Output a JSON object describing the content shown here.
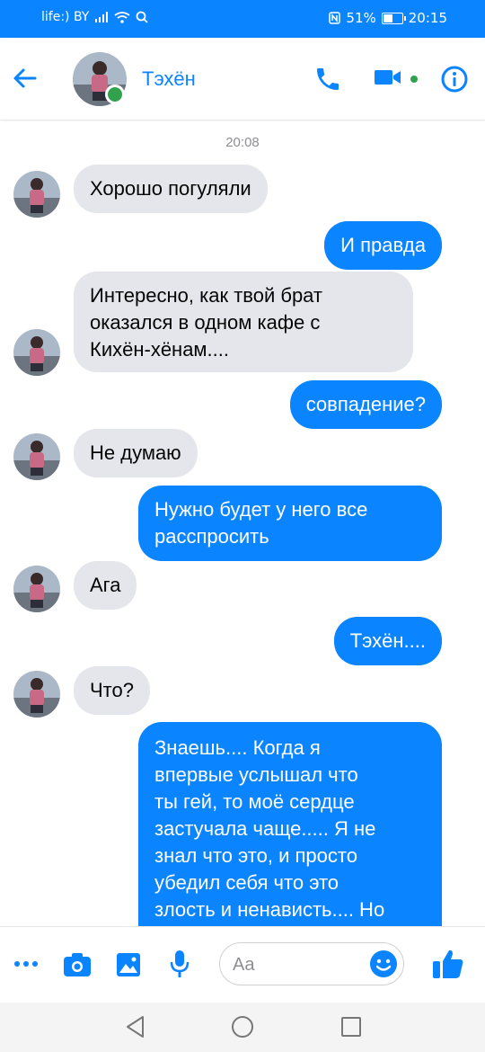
{
  "status_bar": {
    "carrier": "life:) BY",
    "battery": "51%",
    "battery_level": 0.51,
    "time": "20:15"
  },
  "header": {
    "contact_name": "Тэхён",
    "online": true,
    "icons": [
      "back-arrow-icon",
      "phone-icon",
      "video-camera-icon",
      "info-icon"
    ]
  },
  "conversation": {
    "timestamp": "20:08",
    "messages": [
      {
        "from": "them",
        "text": "Хорошо погуляли"
      },
      {
        "from": "me",
        "text": "И правда"
      },
      {
        "from": "them",
        "lines": [
          "Интересно, как твой брат",
          "оказался в одном кафе с",
          "Кихён-хёнам...."
        ]
      },
      {
        "from": "me",
        "text": "совпадение?"
      },
      {
        "from": "them",
        "text": "Не думаю"
      },
      {
        "from": "me",
        "lines": [
          "Нужно будет у него все",
          "расспросить"
        ]
      },
      {
        "from": "them",
        "text": "Ага"
      },
      {
        "from": "me",
        "text": "Тэхён...."
      },
      {
        "from": "them",
        "text": "Что?"
      },
      {
        "from": "me",
        "lines": [
          "Знаешь.... Когда я",
          "впервые услышал что",
          "ты гей, то моё сердце",
          "застучала чаще..... Я не",
          "знал что это, и просто",
          "убедил себя что это",
          "злость и ненависть.... Но"
        ]
      }
    ]
  },
  "composer": {
    "placeholder": "Aa",
    "icons": [
      "more-icon",
      "camera-icon",
      "gallery-icon",
      "microphone-icon",
      "emoji-icon",
      "thumbs-up-icon"
    ]
  },
  "colors": {
    "accent": "#0b84ff",
    "incoming_bubble": "#e4e6eb",
    "online": "#31a24c"
  }
}
